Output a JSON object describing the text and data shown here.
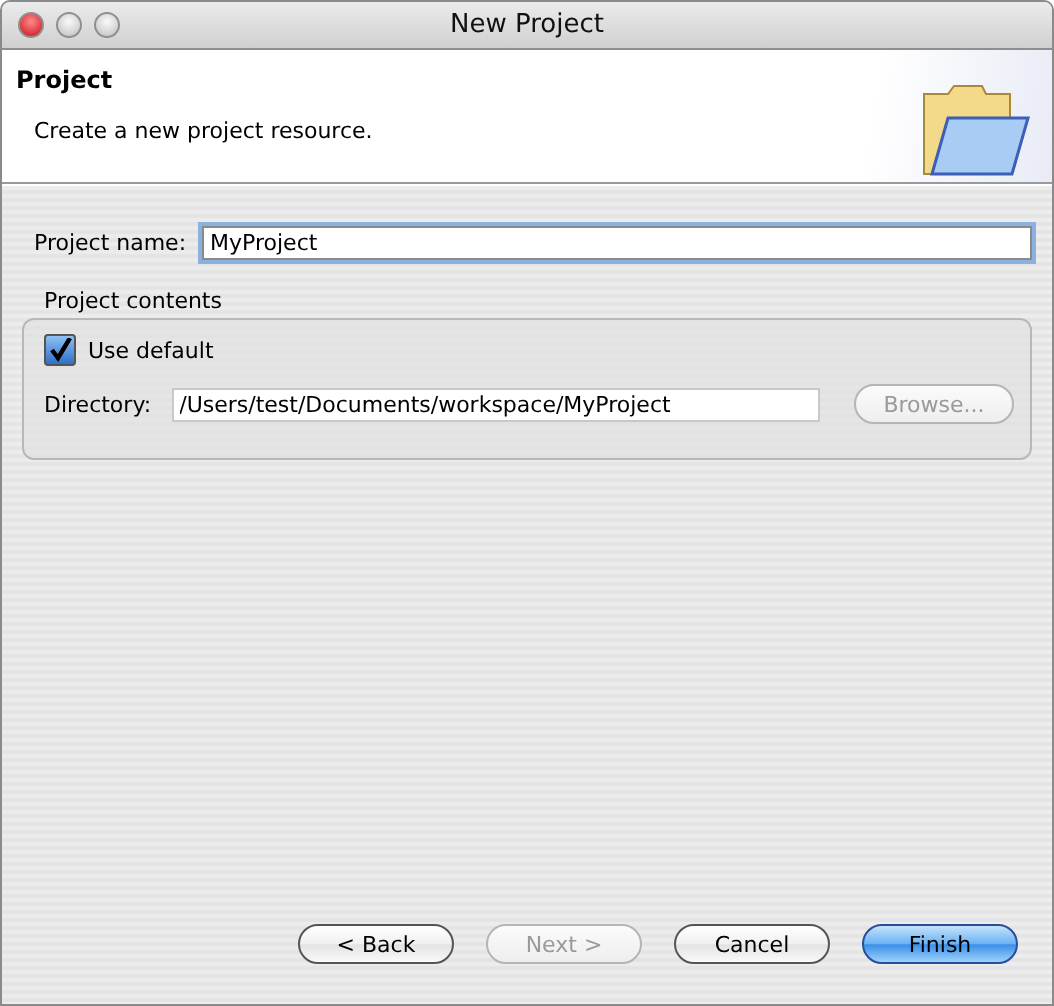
{
  "window": {
    "title": "New Project"
  },
  "header": {
    "title": "Project",
    "description": "Create a new project resource."
  },
  "project_name": {
    "label": "Project name:",
    "value": "MyProject",
    "focused": true
  },
  "project_contents": {
    "label": "Project contents",
    "use_default": {
      "label": "Use default",
      "checked": true
    },
    "directory": {
      "label": "Directory:",
      "value": "/Users/test/Documents/workspace/MyProject"
    },
    "browse": {
      "label": "Browse...",
      "disabled": true
    }
  },
  "buttons": [
    {
      "label": "< Back",
      "disabled": false,
      "default": false
    },
    {
      "label": "Next >",
      "disabled": true,
      "default": false
    },
    {
      "label": "Cancel",
      "disabled": false,
      "default": false
    },
    {
      "label": "Finish",
      "disabled": false,
      "default": true
    }
  ]
}
